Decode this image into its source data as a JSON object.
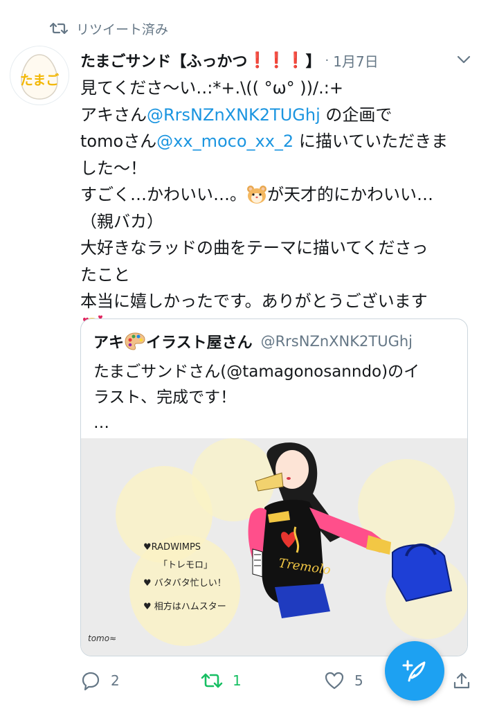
{
  "retweet_notice": {
    "label": "リツイート済み"
  },
  "avatar": {
    "text": "たまご"
  },
  "header": {
    "display_name": "たまごサンド【ふっかつ",
    "exclamations": "❗❗❗",
    "name_tail": "】",
    "separator": "·",
    "date": "1月7日"
  },
  "tweet": {
    "line1": "見てくださ〜い‥:*+.\\(( °ω° ))/.:+",
    "line2_pre": "アキさん",
    "line2_mention": "@RrsNZnXNK2TUGhj",
    "line2_post": " の企画で",
    "line3_pre": "tomoさん",
    "line3_mention": "@xx_moco_xx_2",
    "line3_post": " に描いていただきま",
    "line4": "した〜！",
    "line5_pre": "すごく…かわいい…。",
    "line5_post": "が天才的にかわいい…",
    "line6": "（親バカ）",
    "line7": "大好きなラッドの曲をテーマに描いてくださっ",
    "line8": "たこと",
    "line9": "本当に嬉しかったです。ありがとうございます"
  },
  "quote": {
    "name_pre": "アキ",
    "name_post": "イラスト屋さん",
    "handle": "@RrsNZnXNK2TUGhj",
    "line1": "たまごサンドさん(@tamagonosanndo)のイ",
    "line2": "ラスト、完成です！",
    "line3": "…",
    "image_caption": {
      "line1": "♥RADWIMPS",
      "line2": "「トレモロ」",
      "line3": "♥ バタバタ忙しい！",
      "line4": "♥ 相方はハムスター"
    },
    "sweater_text": "Tremolo",
    "signature": "tomo≈"
  },
  "actions": {
    "reply_count": "2",
    "retweet_count": "1",
    "like_count": "5"
  },
  "colors": {
    "link": "#1b95e0",
    "muted": "#657786",
    "retweet_green": "#17bf63",
    "fab_blue": "#1da1f2",
    "accent_red": "#e0245e"
  },
  "icons": [
    "retweet-icon",
    "chevron-down-icon",
    "hamster-emoji-icon",
    "smiling-hearts-emoji-icon",
    "palette-emoji-icon",
    "reply-icon",
    "like-icon",
    "compose-tweet-icon",
    "share-icon"
  ]
}
